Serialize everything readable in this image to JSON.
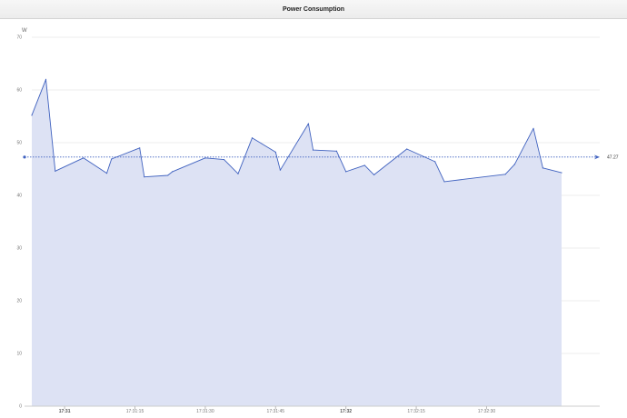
{
  "window": {
    "title": "Power Consumption"
  },
  "chart_data": {
    "type": "area",
    "title": "Power Consumption",
    "ylabel": "W",
    "ylim": [
      0,
      70
    ],
    "y_ticks": [
      0,
      10,
      20,
      30,
      40,
      50,
      60,
      70
    ],
    "xlim": [
      "17:30:53",
      "17:32:46"
    ],
    "x_ticks": [
      {
        "t": "17:31:00",
        "label": "17:31",
        "bold": true
      },
      {
        "t": "17:31:15",
        "label": "17:31:15",
        "bold": false
      },
      {
        "t": "17:31:30",
        "label": "17:31:30",
        "bold": false
      },
      {
        "t": "17:31:45",
        "label": "17:31:45",
        "bold": false
      },
      {
        "t": "17:32:00",
        "label": "17:32",
        "bold": true
      },
      {
        "t": "17:32:15",
        "label": "17:32:15",
        "bold": false
      },
      {
        "t": "17:32:30",
        "label": "17:32:30",
        "bold": false
      }
    ],
    "grid": true,
    "series": [
      {
        "color": "#3f61bf",
        "fill": "#dde2f4",
        "points": [
          {
            "t": "17:30:53",
            "y": 55.2
          },
          {
            "t": "17:30:56",
            "y": 62.0
          },
          {
            "t": "17:30:58",
            "y": 44.6
          },
          {
            "t": "17:31:04",
            "y": 47.1
          },
          {
            "t": "17:31:09",
            "y": 44.2
          },
          {
            "t": "17:31:10",
            "y": 46.9
          },
          {
            "t": "17:31:16",
            "y": 49.0
          },
          {
            "t": "17:31:17",
            "y": 43.5
          },
          {
            "t": "17:31:22",
            "y": 43.8
          },
          {
            "t": "17:31:23",
            "y": 44.5
          },
          {
            "t": "17:31:30",
            "y": 47.1
          },
          {
            "t": "17:31:34",
            "y": 46.8
          },
          {
            "t": "17:31:37",
            "y": 44.1
          },
          {
            "t": "17:31:40",
            "y": 50.9
          },
          {
            "t": "17:31:45",
            "y": 48.2
          },
          {
            "t": "17:31:46",
            "y": 44.8
          },
          {
            "t": "17:31:52",
            "y": 53.6
          },
          {
            "t": "17:31:53",
            "y": 48.6
          },
          {
            "t": "17:31:58",
            "y": 48.4
          },
          {
            "t": "17:32:00",
            "y": 44.5
          },
          {
            "t": "17:32:04",
            "y": 45.7
          },
          {
            "t": "17:32:06",
            "y": 43.9
          },
          {
            "t": "17:32:13",
            "y": 48.8
          },
          {
            "t": "17:32:19",
            "y": 46.4
          },
          {
            "t": "17:32:21",
            "y": 42.6
          },
          {
            "t": "17:32:34",
            "y": 44.0
          },
          {
            "t": "17:32:36",
            "y": 45.9
          },
          {
            "t": "17:32:40",
            "y": 52.7
          },
          {
            "t": "17:32:42",
            "y": 45.2
          },
          {
            "t": "17:32:46",
            "y": 44.3
          }
        ]
      }
    ],
    "average": {
      "value": 47.27,
      "label": "47.27",
      "color": "#3f61bf"
    }
  }
}
